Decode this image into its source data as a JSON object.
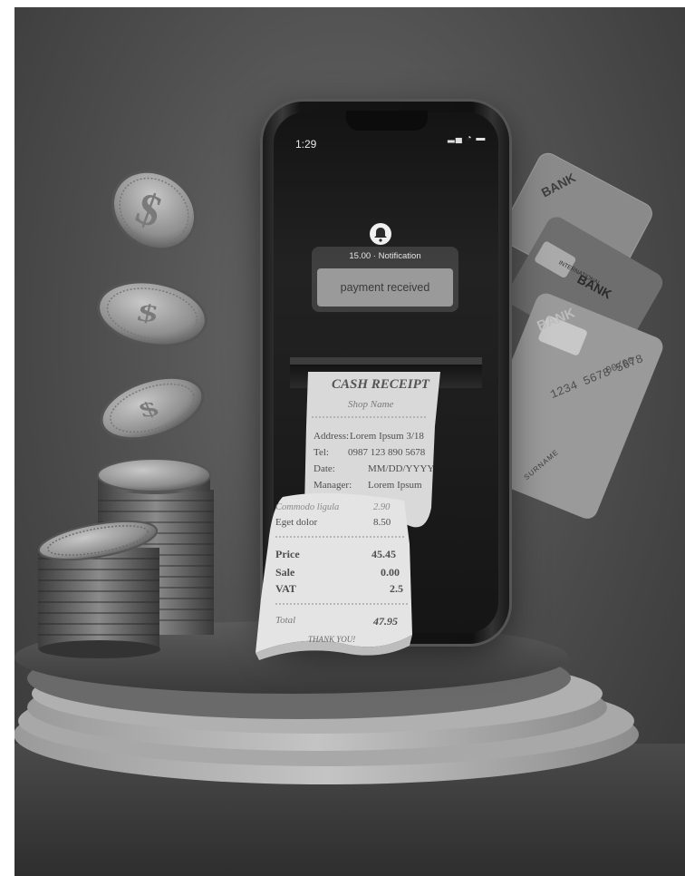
{
  "phone": {
    "status_time": "1:29",
    "status_icons": "▂▄ ◔ ▬",
    "notification": {
      "header": "15.00 · Notification",
      "message": "payment received"
    }
  },
  "receipt": {
    "title": "CASH RECEIPT",
    "shop_name": "Shop Name",
    "rows": [
      {
        "label": "Address:",
        "value": "Lorem Ipsum 3/18"
      },
      {
        "label": "Tel:",
        "value": "0987 123 890 5678"
      },
      {
        "label": "Date:",
        "value": "MM/DD/YYYY"
      },
      {
        "label": "Manager:",
        "value": "Lorem Ipsum"
      }
    ]
  },
  "receipt_front": {
    "items": [
      {
        "label": "Commodo ligula",
        "value": "2.90"
      },
      {
        "label": "Eget dolor",
        "value": "8.50"
      }
    ],
    "totals": [
      {
        "label": "Price",
        "value": "45.45"
      },
      {
        "label": "Sale",
        "value": "0.00"
      },
      {
        "label": "VAT",
        "value": "2.5"
      }
    ],
    "total_label": "Total",
    "total_value": "47.95",
    "footer": "THANK YOU!"
  },
  "cards": {
    "back_label": "BANK",
    "middle_label": "BANK",
    "middle_sub": "INTERNATIONAL",
    "front_label": "BANK",
    "front_number": "1234 5678 5678",
    "front_expiry": "00/00",
    "front_name": "SURNAME"
  },
  "coins": {
    "symbol": "$"
  },
  "colors": {
    "background": "#4e4e4e",
    "paper": "#e2e2e2",
    "notification_box": "#9a9a9a"
  }
}
